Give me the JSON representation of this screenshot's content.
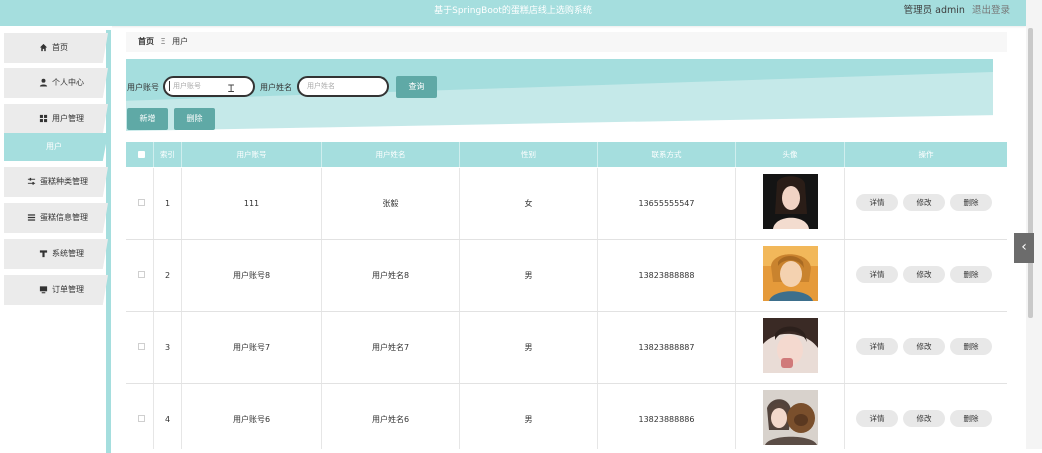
{
  "header": {
    "title": "基于SpringBoot的蛋糕店线上选购系统",
    "user": "管理员 admin",
    "logout": "退出登录"
  },
  "sidebar": {
    "items": [
      {
        "icon": "home-icon",
        "label": "首页"
      },
      {
        "icon": "person-icon",
        "label": "个人中心"
      },
      {
        "icon": "grid-icon",
        "label": "用户管理"
      },
      {
        "label": "用户"
      },
      {
        "icon": "sliders-icon",
        "label": "蛋糕种类管理"
      },
      {
        "icon": "list-icon",
        "label": "蛋糕信息管理"
      },
      {
        "icon": "funnel-icon",
        "label": "系统管理"
      },
      {
        "icon": "monitor-icon",
        "label": "订单管理"
      }
    ]
  },
  "breadcrumb": {
    "home": "首页",
    "sep": "Ξ",
    "current": "用户"
  },
  "search": {
    "account_label": "用户账号",
    "account_placeholder": "用户账号",
    "name_label": "用户姓名",
    "name_placeholder": "用户姓名",
    "query_button": "查询"
  },
  "actions": {
    "add": "新增",
    "delete": "删除"
  },
  "table": {
    "headers": [
      "索引",
      "用户账号",
      "用户姓名",
      "性别",
      "联系方式",
      "头像",
      "操作"
    ],
    "row_buttons": {
      "detail": "详情",
      "edit": "修改",
      "delete": "删除"
    },
    "rows": [
      {
        "index": "1",
        "account": "111",
        "name": "张毅",
        "gender": "女",
        "phone": "13655555547",
        "avatar": "portrait-photo"
      },
      {
        "index": "2",
        "account": "用户账号8",
        "name": "用户姓名8",
        "gender": "男",
        "phone": "13823888888",
        "avatar": "anime-portrait"
      },
      {
        "index": "3",
        "account": "用户账号7",
        "name": "用户姓名7",
        "gender": "男",
        "phone": "13823888887",
        "avatar": "selfie-photo"
      },
      {
        "index": "4",
        "account": "用户账号6",
        "name": "用户姓名6",
        "gender": "男",
        "phone": "13823888886",
        "avatar": "dog-photo"
      }
    ]
  },
  "colors": {
    "accent": "#a5dede",
    "button": "#5fa9a6",
    "active": "#a5dede"
  }
}
